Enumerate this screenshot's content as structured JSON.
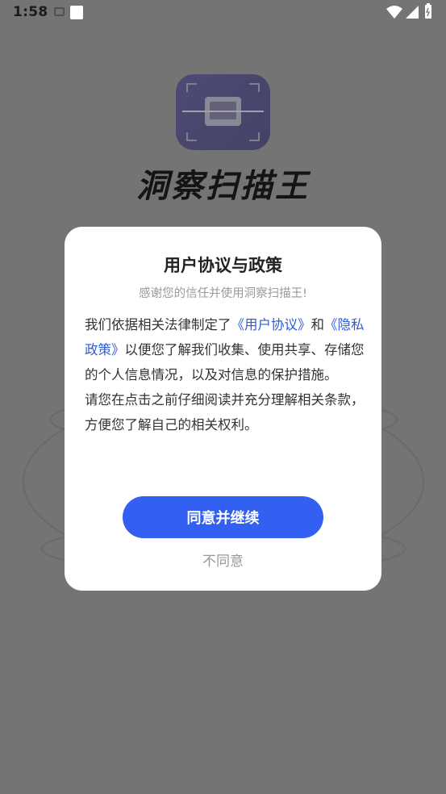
{
  "status_bar": {
    "time": "1:58",
    "icons": [
      "cast-icon",
      "notification-square-icon",
      "wifi-icon",
      "signal-icon",
      "battery-icon"
    ]
  },
  "background": {
    "app_name": "洞察扫描王",
    "logo_icon": "scan-photo-icon",
    "logo_color": "#2f2a78"
  },
  "dialog": {
    "title": "用户协议与政策",
    "subtitle": "感谢您的信任并使用洞察扫描王!",
    "body_part1": "我们依据相关法律制定了",
    "link_user_agreement": "《用户协议》",
    "body_and": "和",
    "link_privacy_policy": "《隐私政策》",
    "body_part2": "以便您了解我们收集、使用共享、存储您的个人信息情况，以及对信息的保护措施。",
    "body_part3": "请您在点击之前仔细阅读并充分理解相关条款，方便您了解自己的相关权利。",
    "agree_label": "同意并继续",
    "disagree_label": "不同意",
    "accent_color": "#3360f0",
    "link_color": "#2f5bd9"
  }
}
